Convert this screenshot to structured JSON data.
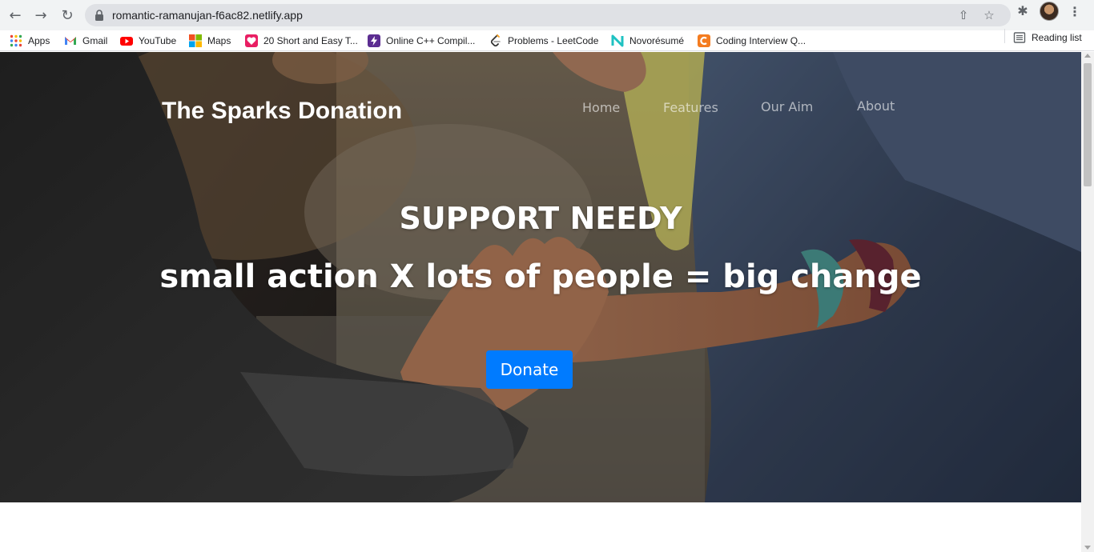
{
  "browser": {
    "url": "romantic-ramanujan-f6ac82.netlify.app",
    "bookmarks": [
      {
        "label": "Apps"
      },
      {
        "label": "Gmail"
      },
      {
        "label": "YouTube"
      },
      {
        "label": "Maps"
      },
      {
        "label": "20 Short and Easy T..."
      },
      {
        "label": "Online C++ Compil..."
      },
      {
        "label": "Problems - LeetCode"
      },
      {
        "label": "Novorésumé"
      },
      {
        "label": "Coding Interview Q..."
      }
    ],
    "reading_list": "Reading list"
  },
  "page": {
    "brand": "The Sparks Donation",
    "nav": [
      "Home",
      "Features",
      "Our Aim",
      "About"
    ],
    "headline": "SUPPORT NEEDY",
    "tagline": "small action X lots of people = big change",
    "donate_label": "Donate"
  }
}
